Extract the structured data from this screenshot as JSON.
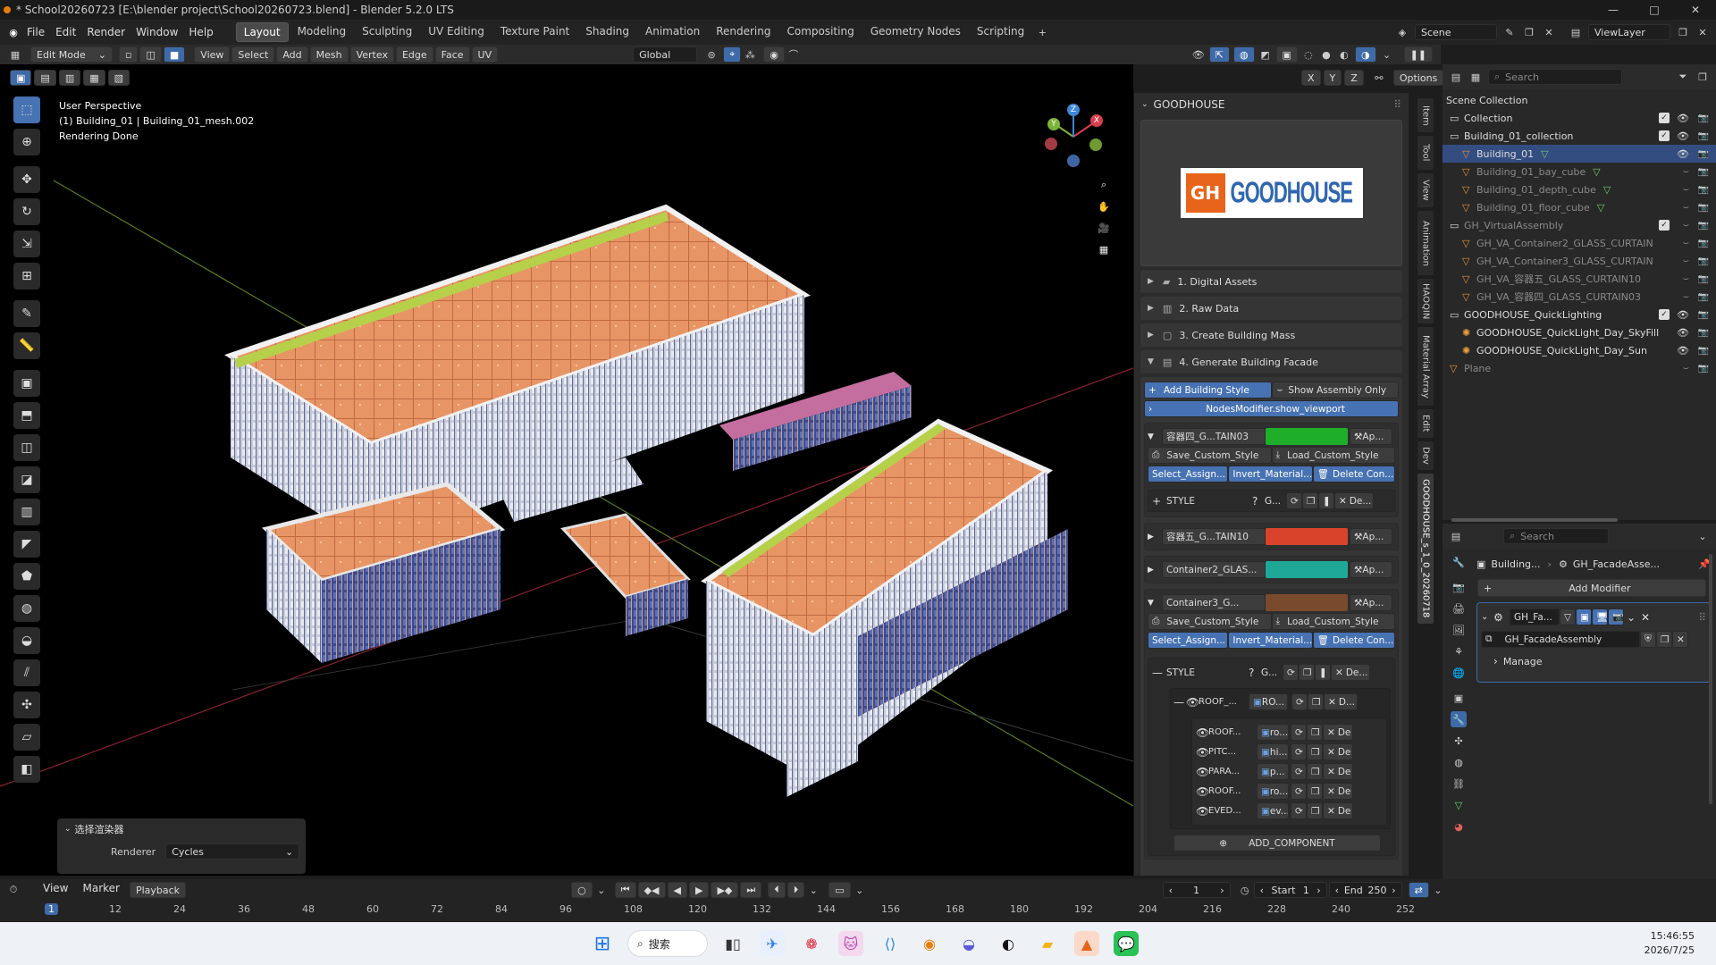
{
  "titlebar": {
    "title": "* School20260723 [E:\\blender project\\School20260723.blend] - Blender 5.2.0 LTS",
    "minimize": "—",
    "maximize": "□",
    "close": "✕"
  },
  "menu": [
    "File",
    "Edit",
    "Render",
    "Window",
    "Help"
  ],
  "workspaces": [
    "Layout",
    "Modeling",
    "Sculpting",
    "UV Editing",
    "Texture Paint",
    "Shading",
    "Animation",
    "Rendering",
    "Compositing",
    "Geometry Nodes",
    "Scripting"
  ],
  "scene": {
    "scene_name": "Scene",
    "view_layer": "ViewLayer"
  },
  "vp_header": {
    "mode": "Edit Mode",
    "menus": [
      "View",
      "Select",
      "Add",
      "Mesh",
      "Vertex",
      "Edge",
      "Face",
      "UV"
    ],
    "transform": "Global",
    "axes": [
      "X",
      "Y",
      "Z"
    ],
    "options": "Options"
  },
  "viewport": {
    "line1": "User Perspective",
    "line2": "(1) Building_01 | Building_01_mesh.002",
    "line3": "Rendering Done"
  },
  "gizmo": {
    "x": "X",
    "y": "Y",
    "z": "Z"
  },
  "last_op": {
    "title": "选择渲染器",
    "label": "Renderer",
    "value": "Cycles"
  },
  "npanel": {
    "title": "GOODHOUSE",
    "logo_text": "GOODHOUSE",
    "logo_mark": "GH",
    "sections": [
      "1. Digital Assets",
      "2. Raw Data",
      "3. Create Building Mass",
      "4. Generate Building Facade"
    ],
    "add_style": "Add Building Style",
    "show_assembly": "Show Assembly Only",
    "nodes_modifier": "NodesModifier.show_viewport",
    "styles": [
      {
        "name": "容器四_G...TAIN03",
        "color": "#1fae2a",
        "ap": "Ap...",
        "expanded": true
      },
      {
        "name": "容器五_G...TAIN10",
        "color": "#d8432c",
        "ap": "Ap...",
        "expanded": false
      },
      {
        "name": "Container2_GLAS...",
        "color": "#1fa898",
        "ap": "Ap...",
        "expanded": false
      },
      {
        "name": "Container3_G...",
        "color": "#7a4a2c",
        "ap": "Ap...",
        "expanded": true
      }
    ],
    "save_style": "Save_Custom_Style",
    "load_style": "Load_Custom_Style",
    "select_assign": "Select_Assign...",
    "invert_material": "Invert_Material...",
    "delete_con": "Delete Con...",
    "style_label": "STYLE",
    "g_label": "G...",
    "de_label": "De...",
    "roof_group": {
      "name": "ROOF_...",
      "sub": "RO...",
      "d": "D..."
    },
    "components": [
      {
        "name": "ROOF...",
        "sub": "ro..."
      },
      {
        "name": "PITC...",
        "sub": "hi..."
      },
      {
        "name": "PARA...",
        "sub": "p..."
      },
      {
        "name": "ROOF...",
        "sub": "ro..."
      },
      {
        "name": "EVED...",
        "sub": "ev..."
      }
    ],
    "comp_de": "De",
    "add_component": "ADD_COMPONENT"
  },
  "vtabs": [
    "Item",
    "Tool",
    "View",
    "Animation",
    "HAOQIN",
    "Material Array",
    "Edit",
    "Dev",
    "GOODHOUSE_s_1_0_20260718"
  ],
  "outliner": {
    "search": "Search",
    "root": "Scene Collection",
    "rows": [
      {
        "name": "Collection",
        "indent": 0,
        "type": "coll",
        "dim": false
      },
      {
        "name": "Building_01_collection",
        "indent": 0,
        "type": "coll",
        "dim": false
      },
      {
        "name": "Building_01",
        "indent": 1,
        "type": "mesh",
        "dim": false,
        "selected": true
      },
      {
        "name": "Building_01_bay_cube",
        "indent": 1,
        "type": "mesh",
        "dim": true
      },
      {
        "name": "Building_01_depth_cube",
        "indent": 1,
        "type": "mesh",
        "dim": true
      },
      {
        "name": "Building_01_floor_cube",
        "indent": 1,
        "type": "mesh",
        "dim": true
      },
      {
        "name": "GH_VirtualAssembly",
        "indent": 0,
        "type": "coll",
        "dim": true
      },
      {
        "name": "GH_VA_Container2_GLASS_CURTAIN",
        "indent": 1,
        "type": "mesh",
        "dim": true
      },
      {
        "name": "GH_VA_Container3_GLASS_CURTAIN",
        "indent": 1,
        "type": "mesh",
        "dim": true
      },
      {
        "name": "GH_VA_容器五_GLASS_CURTAIN10",
        "indent": 1,
        "type": "mesh",
        "dim": true
      },
      {
        "name": "GH_VA_容器四_GLASS_CURTAIN03",
        "indent": 1,
        "type": "mesh",
        "dim": true
      },
      {
        "name": "GOODHOUSE_QuickLighting",
        "indent": 0,
        "type": "coll",
        "dim": false
      },
      {
        "name": "GOODHOUSE_QuickLight_Day_SkyFill",
        "indent": 1,
        "type": "light",
        "dim": false
      },
      {
        "name": "GOODHOUSE_QuickLight_Day_Sun",
        "indent": 1,
        "type": "light",
        "dim": false
      },
      {
        "name": "Plane",
        "indent": 0,
        "type": "mesh",
        "dim": true
      }
    ]
  },
  "properties": {
    "search": "Search",
    "breadcrumb_obj": "Building...",
    "breadcrumb_mod": "GH_FacadeAsse...",
    "add_modifier": "Add Modifier",
    "modifier_name": "GH_Fa...",
    "node_group": "GH_FacadeAssembly",
    "manage": "Manage"
  },
  "timeline": {
    "menus": [
      "View",
      "Marker",
      "Playback"
    ],
    "current_frame": "1",
    "start_label": "Start",
    "start": "1",
    "end_label": "End",
    "end": "250",
    "ticks": [
      "1",
      "12",
      "24",
      "36",
      "48",
      "60",
      "72",
      "84",
      "96",
      "108",
      "120",
      "132",
      "144",
      "156",
      "168",
      "180",
      "192",
      "204",
      "216",
      "228",
      "240",
      "252"
    ]
  },
  "taskbar": {
    "search": "搜索",
    "time": "15:46:55",
    "date": "2026/7/25"
  }
}
